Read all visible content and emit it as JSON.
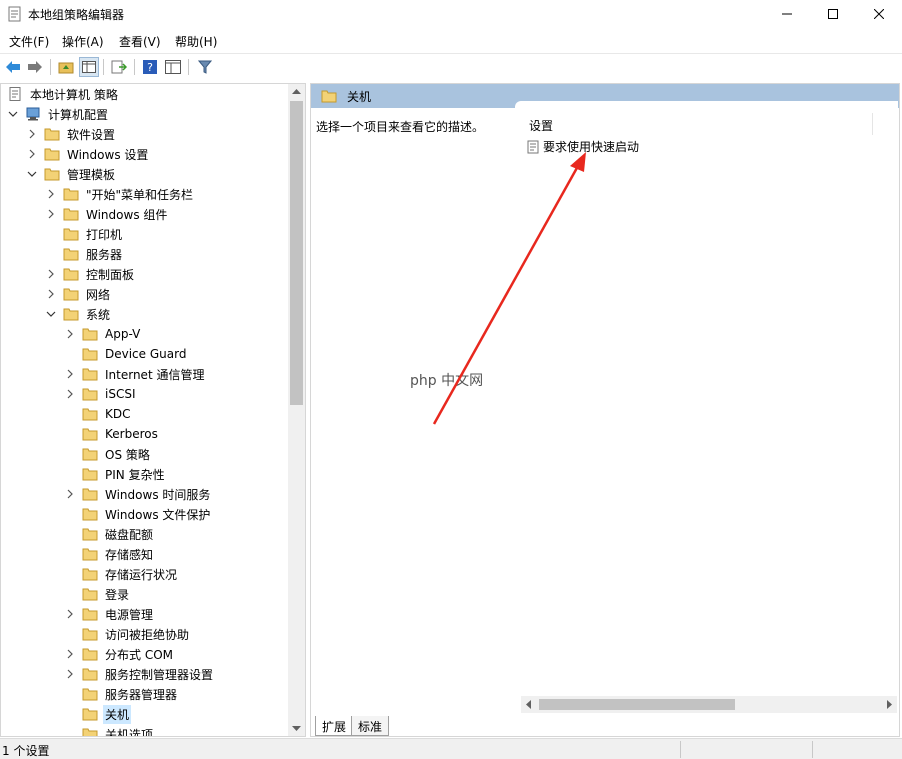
{
  "window": {
    "title": "本地组策略编辑器",
    "icon": "policy-editor-icon"
  },
  "menu": {
    "items": [
      {
        "label": "文件(F)"
      },
      {
        "label": "操作(A)"
      },
      {
        "label": "查看(V)"
      },
      {
        "label": "帮助(H)"
      }
    ]
  },
  "toolbar": {
    "buttons": [
      "back-icon",
      "forward-icon",
      "up-folder-icon",
      "show-hide-tree-icon",
      "export-list-icon",
      "help-icon",
      "properties-icon",
      "filter-icon"
    ]
  },
  "tree": {
    "root": "本地计算机 策略",
    "computer_config": "计算机配置",
    "software_settings": "软件设置",
    "windows_settings": "Windows 设置",
    "admin_templates": "管理模板",
    "start_menu": "\"开始\"菜单和任务栏",
    "windows_components": "Windows 组件",
    "printers": "打印机",
    "server": "服务器",
    "control_panel": "控制面板",
    "network": "网络",
    "system": "系统",
    "system_children": [
      "App-V",
      "Device Guard",
      "Internet 通信管理",
      "iSCSI",
      "KDC",
      "Kerberos",
      "OS 策略",
      "PIN 复杂性",
      "Windows 时间服务",
      "Windows 文件保护",
      "磁盘配额",
      "存储感知",
      "存储运行状况",
      "登录",
      "电源管理",
      "访问被拒绝协助",
      "分布式 COM",
      "服务控制管理器设置",
      "服务器管理器",
      "关机",
      "关机选项"
    ]
  },
  "right": {
    "header": "关机",
    "description": "选择一个项目来查看它的描述。",
    "column_header": "设置",
    "setting": "要求使用快速启动",
    "tabs": [
      "扩展",
      "标准"
    ]
  },
  "status": {
    "text": "1 个设置"
  },
  "watermark": "php 中文网",
  "colors": {
    "header_bg": "#a9c3de",
    "selected_bg": "#cce8ff",
    "arrow": "#e8281e",
    "folder": "#e8c05a"
  }
}
